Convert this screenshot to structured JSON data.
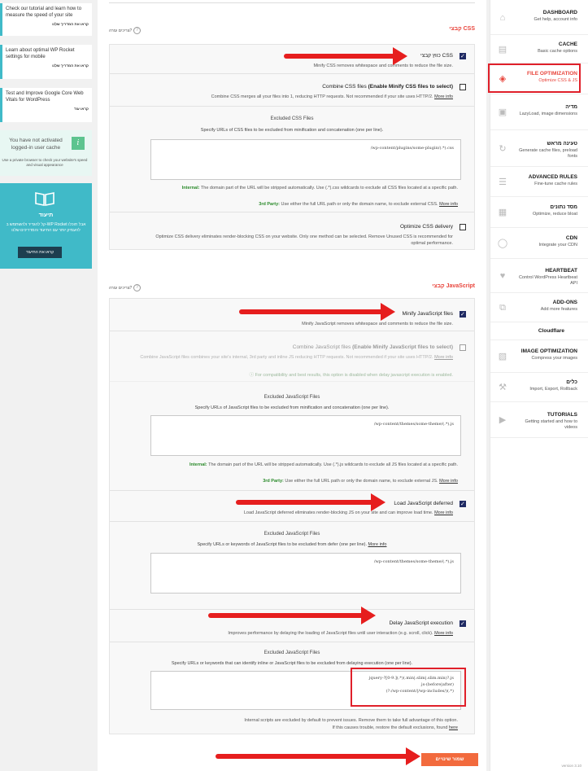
{
  "left": {
    "card1": {
      "text": "Check our tutorial and learn how to measure the speed of your site",
      "link": "קראו את המדריך שלנו"
    },
    "card2": {
      "text": "Learn about optimal WP Rocket settings for mobile",
      "link": "קראו את המדריך שלנו"
    },
    "card3": {
      "text": "Test and Improve Google Core Web Vitals for WordPress",
      "link": "קראו עוד"
    },
    "cache": {
      "text": "You have not activated logged-in user cache",
      "sub": "Use a private browser to check your website's speed and visual appearance"
    },
    "docs": {
      "title": "תיעוד",
      "text": "קל להגדיר ולהשתמש ב-WP Rocket אבל תוכלו להעמיק יותר עם התיעוד והמדריכים שלנו",
      "button": "קראו את התיעוד"
    }
  },
  "css": {
    "title": "קבצי CSS",
    "help": "צריכים עזרה?",
    "minify": {
      "label": "כווץ קבצי CSS",
      "desc": "Minify CSS removes whitespace and comments to reduce the file size."
    },
    "combine": {
      "label": "Combine CSS files",
      "label_bold": "(Enable Minify CSS files to select)",
      "desc": "Combine CSS merges all your files into 1, reducing HTTP requests. Not recommended if your site uses HTTP/2.",
      "more": "More info"
    },
    "excluded": {
      "title": "Excluded CSS Files",
      "desc": "Specify URLs of CSS files to be excluded from minification and concatenation (one per line).",
      "value": "/wp-content/plugins/some-plugin/(.*).css"
    },
    "note1_label": "Internal:",
    "note1": "The domain part of the URL will be stripped automatically. Use (.*).css wildcards to exclude all CSS files located at a specific path.",
    "note2_label": "3rd Party:",
    "note2": "Use either the full URL path or only the domain name, to exclude external CSS.",
    "note2_more": "More info",
    "optimize": {
      "label": "Optimize CSS delivery",
      "desc": "Optimize CSS delivery eliminates render-blocking CSS on your website. Only one method can be selected. Remove Unused CSS is recommended for optimal performance."
    }
  },
  "js": {
    "title": "קבצי JavaScript",
    "help": "צריכים עזרה?",
    "minify": {
      "label": "Minify JavaScript files",
      "desc": "Minify JavaScript removes whitespace and comments to reduce the file size."
    },
    "combine": {
      "label": "Combine JavaScript files",
      "label_bold": "(Enable Minify JavaScript files to select)",
      "desc": "Combine JavaScript files combines your site's internal, 3rd party and inline JS reducing HTTP requests. Not recommended if your site uses HTTP/2.",
      "more": "More info",
      "notice": "For compatibility and best results, this option is disabled when delay javascript execution is enabled."
    },
    "excluded": {
      "title": "Excluded JavaScript Files",
      "desc": "Specify URLs of JavaScript files to be excluded from minification and concatenation (one per line).",
      "value": "/wp-content/themes/some-theme/(.*).js"
    },
    "note1_label": "Internal:",
    "note1": "The domain part of the URL will be stripped automatically. Use (.*).js wildcards to exclude all JS files located at a specific path.",
    "note2_label": "3rd Party:",
    "note2": "Use either the full URL path or only the domain name, to exclude external JS.",
    "note2_more": "More info",
    "defer": {
      "label": "Load JavaScript deferred",
      "desc": "Load JavaScript deferred eliminates render-blocking JS on your site and can improve load time.",
      "more": "More info"
    },
    "defer_excluded": {
      "title": "Excluded JavaScript Files",
      "desc": "Specify URLs or keywords of JavaScript files to be excluded from defer (one per line).",
      "more": "More info",
      "value": "/wp-content/themes/some-theme/(.*).js"
    },
    "delay": {
      "label": "Delay JavaScript execution",
      "desc": "Improves performance by delaying the loading of JavaScript files until user interaction (e.g. scroll, click).",
      "more": "More info"
    },
    "delay_excluded": {
      "title": "Excluded JavaScript Files",
      "desc": "Specify URLs or keywords that can identify inline or JavaScript files to be excluded from delaying execution (one per line).",
      "value": "jquery-?[0-9.](.*)(.min|.slim|.slim.min)?.js\njs-(before|after)\n(?:/wp-content/|/wp-includes/)(.*)"
    },
    "final_note": "Internal scripts are excluded by default to prevent issues. Remove them to take full advantage of this option.",
    "final_note2": "If this causes trouble, restore the default exclusions, found",
    "final_more": "here"
  },
  "save_button": "שמור שינויים",
  "sidebar": {
    "items": [
      {
        "name": "DASHBOARD",
        "sub": "Get help, account info",
        "icon": "home-icon"
      },
      {
        "name": "CACHE",
        "sub": "Basic cache options",
        "icon": "file-icon"
      },
      {
        "name": "FILE OPTIMIZATION",
        "sub": "Optimize CSS & JS",
        "icon": "layers-icon"
      },
      {
        "name": "מדיה",
        "sub": "LazyLoad, image dimensions",
        "icon": "media-icon"
      },
      {
        "name": "טעינה מראש",
        "sub": "Generate cache files, preload fonts",
        "icon": "refresh-icon"
      },
      {
        "name": "ADVANCED RULES",
        "sub": "Fine-tune cache rules",
        "icon": "list-icon"
      },
      {
        "name": "מסד נתונים",
        "sub": "Optimize, reduce bloat",
        "icon": "database-icon"
      },
      {
        "name": "CDN",
        "sub": "Integrate your CDN",
        "icon": "cdn-icon"
      },
      {
        "name": "HEARTBEAT",
        "sub": "Control WordPress Heartbeat API",
        "icon": "heart-icon"
      },
      {
        "name": "ADD-ONS",
        "sub": "Add more features",
        "icon": "addons-icon"
      },
      {
        "name": "Cloudflare",
        "sub": "",
        "icon": ""
      },
      {
        "name": "IMAGE OPTIMIZATION",
        "sub": "Compress your images",
        "icon": "image-icon"
      },
      {
        "name": "כלים",
        "sub": "Import, Export, Rollback",
        "icon": "tools-icon"
      },
      {
        "name": "TUTORIALS",
        "sub": "Getting started and how to videos",
        "icon": "video-icon"
      }
    ],
    "version": "version 3.10"
  },
  "colors": {
    "accent": "#e8453c",
    "teal": "#40bac8",
    "checkbox": "#1f2a63",
    "highlight": "#e0202a"
  }
}
